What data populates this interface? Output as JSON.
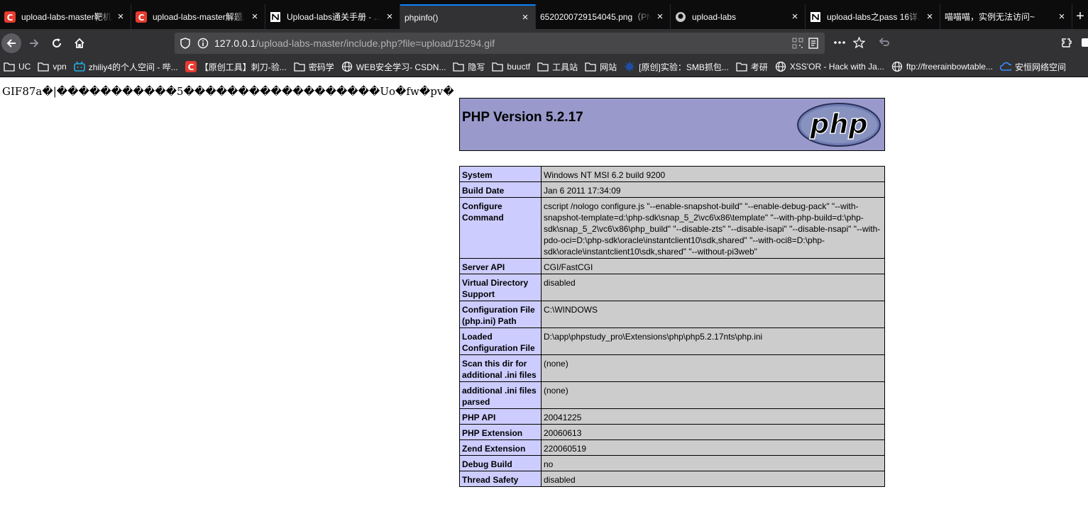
{
  "tabs": [
    {
      "title": "upload-labs-master靶机...",
      "icon": "csdn-icon",
      "active": false
    },
    {
      "title": "upload-labs-master解题...",
      "icon": "csdn-icon",
      "active": false
    },
    {
      "title": "Upload-labs通关手册 - ...",
      "icon": "notion-icon",
      "active": false
    },
    {
      "title": "phpinfo()",
      "icon": "",
      "active": true
    },
    {
      "title": "6520200729154045.png（PN...",
      "icon": "",
      "active": false
    },
    {
      "title": "upload-labs",
      "icon": "github-icon",
      "active": false
    },
    {
      "title": "upload-labs之pass 16详...",
      "icon": "notion-icon",
      "active": false
    },
    {
      "title": "喵喵喵，实例无法访问~",
      "icon": "",
      "active": false
    }
  ],
  "address_bar": {
    "host": "127.0.0.1",
    "path": "/upload-labs-master/include.php?file=upload/15294.gif"
  },
  "bookmarks": [
    {
      "label": "UC",
      "icon": "folder-icon"
    },
    {
      "label": "vpn",
      "icon": "folder-icon"
    },
    {
      "label": "zhiliy4的个人空间 - 哔...",
      "icon": "bilibili-icon"
    },
    {
      "label": "【原创工具】刺刀-验...",
      "icon": "csdn-icon"
    },
    {
      "label": "密码学",
      "icon": "folder-icon"
    },
    {
      "label": "WEB安全学习- CSDN...",
      "icon": "globe-icon"
    },
    {
      "label": "隐写",
      "icon": "folder-icon"
    },
    {
      "label": "buuctf",
      "icon": "folder-icon"
    },
    {
      "label": "工具站",
      "icon": "folder-icon"
    },
    {
      "label": "网站",
      "icon": "folder-icon"
    },
    {
      "label": "[原创]实验：SMB抓包...",
      "icon": "kanxue-icon"
    },
    {
      "label": "考研",
      "icon": "folder-icon"
    },
    {
      "label": "XSS'OR - Hack with Ja...",
      "icon": "globe-icon"
    },
    {
      "label": "ftp://freerainbowtable...",
      "icon": "globe-icon"
    },
    {
      "label": "安恒网络空间",
      "icon": "cloud-icon"
    }
  ],
  "page": {
    "gif_header": "GIF87a�|�����������5������������������Uo�fw�pv�",
    "php_version": "PHP Version 5.2.17",
    "logo_text": "php",
    "rows": [
      {
        "key": "System",
        "value": "Windows NT MSI 6.2 build 9200"
      },
      {
        "key": "Build Date",
        "value": "Jan 6 2011 17:34:09"
      },
      {
        "key": "Configure Command",
        "value": "cscript /nologo configure.js \"--enable-snapshot-build\" \"--enable-debug-pack\" \"--with-snapshot-template=d:\\php-sdk\\snap_5_2\\vc6\\x86\\template\" \"--with-php-build=d:\\php-sdk\\snap_5_2\\vc6\\x86\\php_build\" \"--disable-zts\" \"--disable-isapi\" \"--disable-nsapi\" \"--with-pdo-oci=D:\\php-sdk\\oracle\\instantclient10\\sdk,shared\" \"--with-oci8=D:\\php-sdk\\oracle\\instantclient10\\sdk,shared\" \"--without-pi3web\""
      },
      {
        "key": "Server API",
        "value": "CGI/FastCGI"
      },
      {
        "key": "Virtual Directory Support",
        "value": "disabled"
      },
      {
        "key": "Configuration File (php.ini) Path",
        "value": "C:\\WINDOWS"
      },
      {
        "key": "Loaded Configuration File",
        "value": "D:\\app\\phpstudy_pro\\Extensions\\php\\php5.2.17nts\\php.ini"
      },
      {
        "key": "Scan this dir for additional .ini files",
        "value": "(none)"
      },
      {
        "key": "additional .ini files parsed",
        "value": "(none)"
      },
      {
        "key": "PHP API",
        "value": "20041225"
      },
      {
        "key": "PHP Extension",
        "value": "20060613"
      },
      {
        "key": "Zend Extension",
        "value": "220060519"
      },
      {
        "key": "Debug Build",
        "value": "no"
      },
      {
        "key": "Thread Safety",
        "value": "disabled"
      }
    ]
  },
  "colors": {
    "php_header": "#9999cc",
    "key_cell": "#ccccff",
    "value_cell": "#cccccc",
    "tab_accent": "#0a84ff"
  }
}
